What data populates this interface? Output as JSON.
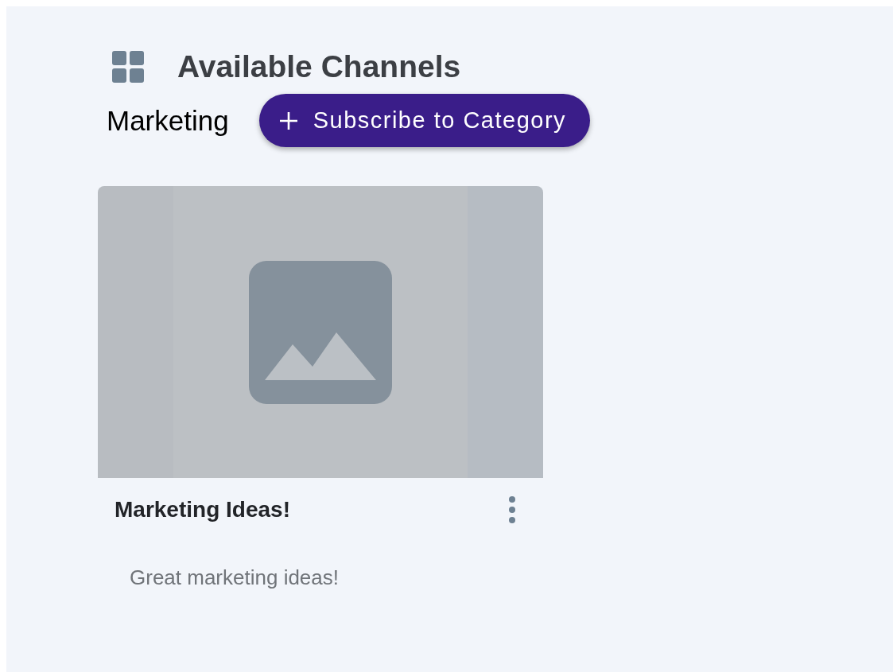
{
  "header": {
    "title": "Available Channels"
  },
  "category": {
    "name": "Marketing",
    "subscribe_button": "Subscribe to Category"
  },
  "channels": [
    {
      "title": "Marketing Ideas!",
      "description": "Great marketing ideas!"
    }
  ]
}
